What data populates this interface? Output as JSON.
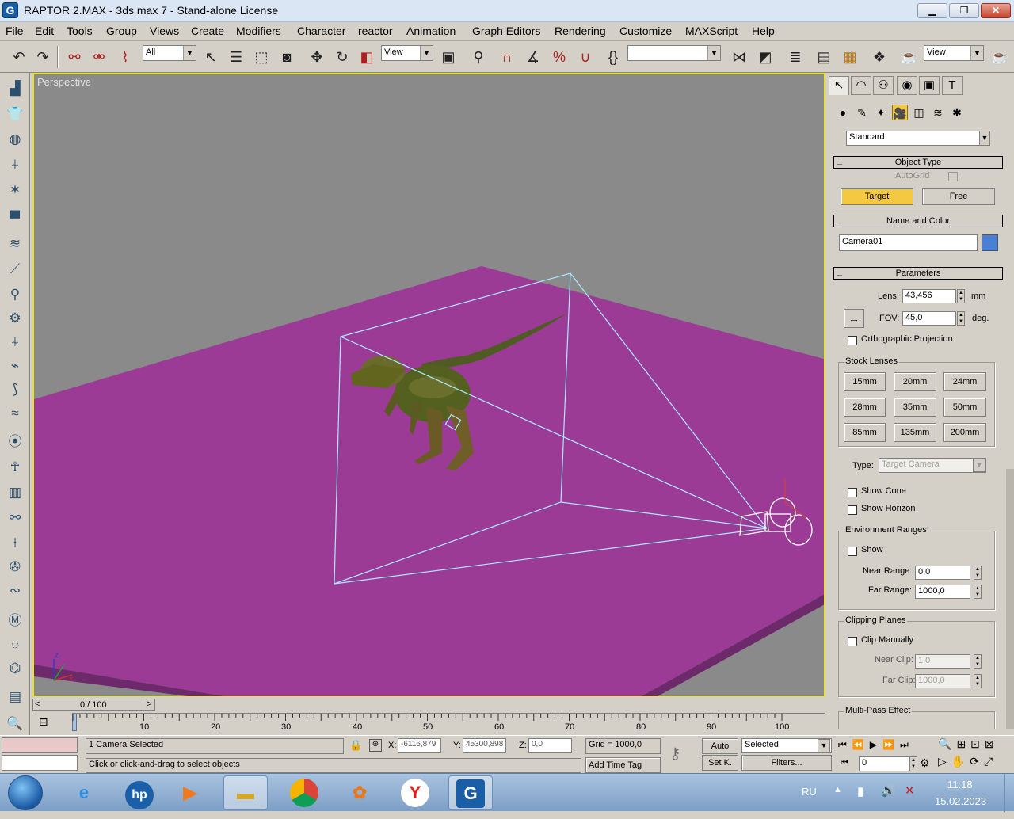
{
  "window": {
    "title": "RAPTOR 2.MAX - 3ds max 7  - Stand-alone License",
    "app_icon": "3dsmax-logo-icon",
    "minimize": "▁",
    "maximize": "❐",
    "close": "✕"
  },
  "menu": [
    "File",
    "Edit",
    "Tools",
    "Group",
    "Views",
    "Create",
    "Modifiers",
    "Character",
    "reactor",
    "Animation",
    "Graph Editors",
    "Rendering",
    "Customize",
    "MAXScript",
    "Help"
  ],
  "toolbar": {
    "selection_filter": "All",
    "ref_coord": "View",
    "named_selection": "",
    "render_type": "View"
  },
  "viewport": {
    "label": "Perspective",
    "background_color": "#8a8a8a",
    "ground_color": "#9c3b96",
    "frustum_color": "#a9e9ff"
  },
  "command_panel": {
    "category_dropdown": "Standard",
    "object_type": {
      "title": "Object Type",
      "autogrid": "AutoGrid",
      "target_button": "Target",
      "free_button": "Free"
    },
    "name_and_color": {
      "title": "Name and Color",
      "name": "Camera01",
      "swatch_color": "#4a7fd6"
    },
    "parameters": {
      "title": "Parameters",
      "lens_label": "Lens:",
      "lens_value": "43,456",
      "lens_unit": "mm",
      "fov_label": "FOV:",
      "fov_value": "45,0",
      "fov_unit": "deg.",
      "ortho": "Orthographic Projection",
      "stock_lenses_title": "Stock Lenses",
      "stock_lenses": [
        "15mm",
        "20mm",
        "24mm",
        "28mm",
        "35mm",
        "50mm",
        "85mm",
        "135mm",
        "200mm"
      ],
      "type_label": "Type:",
      "type_value": "Target Camera",
      "show_cone": "Show Cone",
      "show_horizon": "Show Horizon",
      "env_title": "Environment Ranges",
      "env_show": "Show",
      "near_range_label": "Near Range:",
      "near_range_value": "0,0",
      "far_range_label": "Far Range:",
      "far_range_value": "1000,0",
      "clip_title": "Clipping Planes",
      "clip_manually": "Clip Manually",
      "near_clip_label": "Near Clip:",
      "near_clip_value": "1,0",
      "far_clip_label": "Far Clip:",
      "far_clip_value": "1000,0",
      "multipass_title": "Multi-Pass Effect"
    }
  },
  "timeline": {
    "slider_label": "0 / 100",
    "prev": "<",
    "next": ">",
    "ticks": [
      "10",
      "20",
      "30",
      "40",
      "50",
      "60",
      "70",
      "80",
      "90",
      "100"
    ]
  },
  "status": {
    "selection_info": "1 Camera Selected",
    "prompt": "Click or click-and-drag to select objects",
    "x_label": "X:",
    "x_value": "-6116,879",
    "y_label": "Y:",
    "y_value": "45300,898",
    "z_label": "Z:",
    "z_value": "0,0",
    "grid": "Grid = 1000,0",
    "add_time_tag": "Add Time Tag",
    "auto_key": "Auto",
    "set_key": "Set K.",
    "key_mode": "Selected",
    "filters": "Filters...",
    "frame": "0"
  },
  "taskbar": {
    "language": "RU",
    "time": "11:18",
    "date": "15.02.2023",
    "apps": [
      "start-orb-icon",
      "internet-explorer-icon",
      "hp-icon",
      "media-player-icon",
      "file-explorer-icon",
      "chrome-icon",
      "photo-app-icon",
      "yandex-browser-icon",
      "3dsmax-icon"
    ]
  }
}
